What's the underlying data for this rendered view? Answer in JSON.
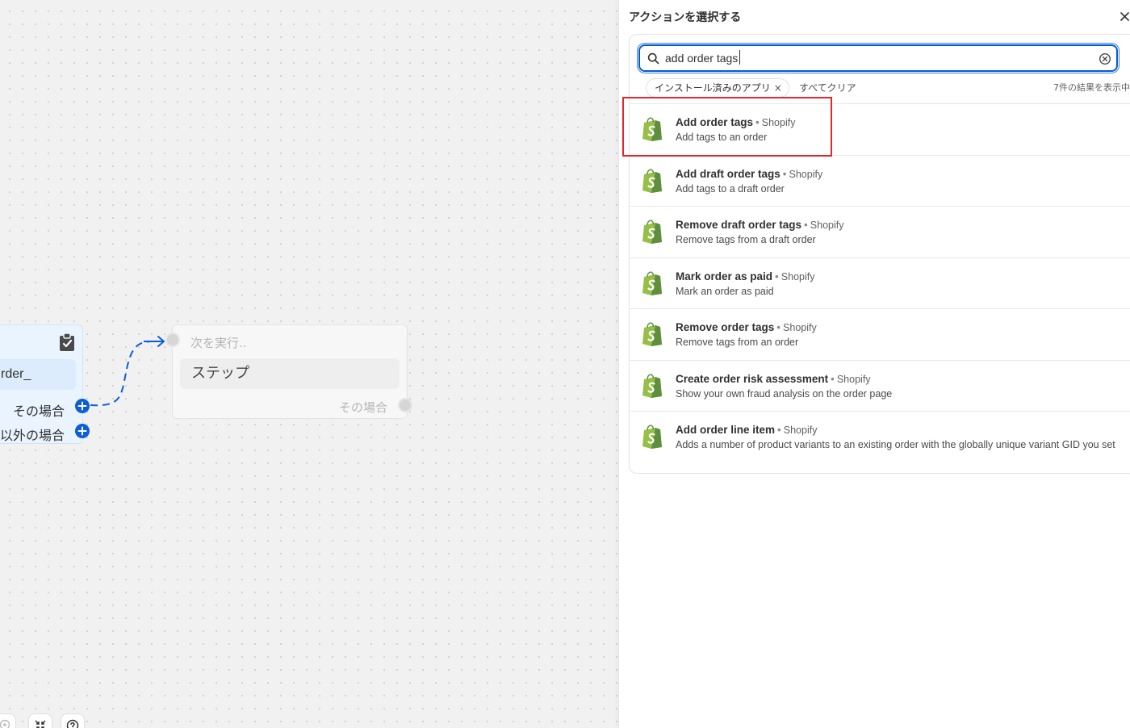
{
  "canvas": {
    "condition_node": {
      "field_value": "rder_",
      "branch_true": "その場合",
      "branch_false": "以外の場合"
    },
    "step_node": {
      "next_label": "次を実行..",
      "step_text": "ステップ",
      "branch_label": "その場合"
    }
  },
  "panel": {
    "title": "アクションを選択する",
    "search": {
      "value": "add order tags",
      "placeholder": ""
    },
    "filter_chip": "インストール済みのアプリ",
    "filter_chip_remove": "×",
    "clear_all": "すべてクリア",
    "result_count": "7件の結果を表示中",
    "results": [
      {
        "name": "Add order tags",
        "vendor": "Shopify",
        "description": "Add tags to an order"
      },
      {
        "name": "Add draft order tags",
        "vendor": "Shopify",
        "description": "Add tags to a draft order"
      },
      {
        "name": "Remove draft order tags",
        "vendor": "Shopify",
        "description": "Remove tags from a draft order"
      },
      {
        "name": "Mark order as paid",
        "vendor": "Shopify",
        "description": "Mark an order as paid"
      },
      {
        "name": "Remove order tags",
        "vendor": "Shopify",
        "description": "Remove tags from an order"
      },
      {
        "name": "Create order risk assessment",
        "vendor": "Shopify",
        "description": "Show your own fraud analysis on the order page"
      },
      {
        "name": "Add order line item",
        "vendor": "Shopify",
        "description": "Adds a number of product variants to an existing order with the globally unique variant GID you set"
      }
    ],
    "separator": "•"
  },
  "colors": {
    "accent": "#005bd3",
    "highlight": "#e5252a",
    "shopify_green": "#95bf47",
    "shopify_dark_green": "#5e8e3e"
  },
  "icons": [
    "clipboard-check-icon",
    "plus-icon",
    "arrow-right-icon",
    "search-icon",
    "clear-circle-icon",
    "close-icon",
    "shopify-logo-icon",
    "zoom-icon",
    "fit-view-icon",
    "help-icon"
  ]
}
